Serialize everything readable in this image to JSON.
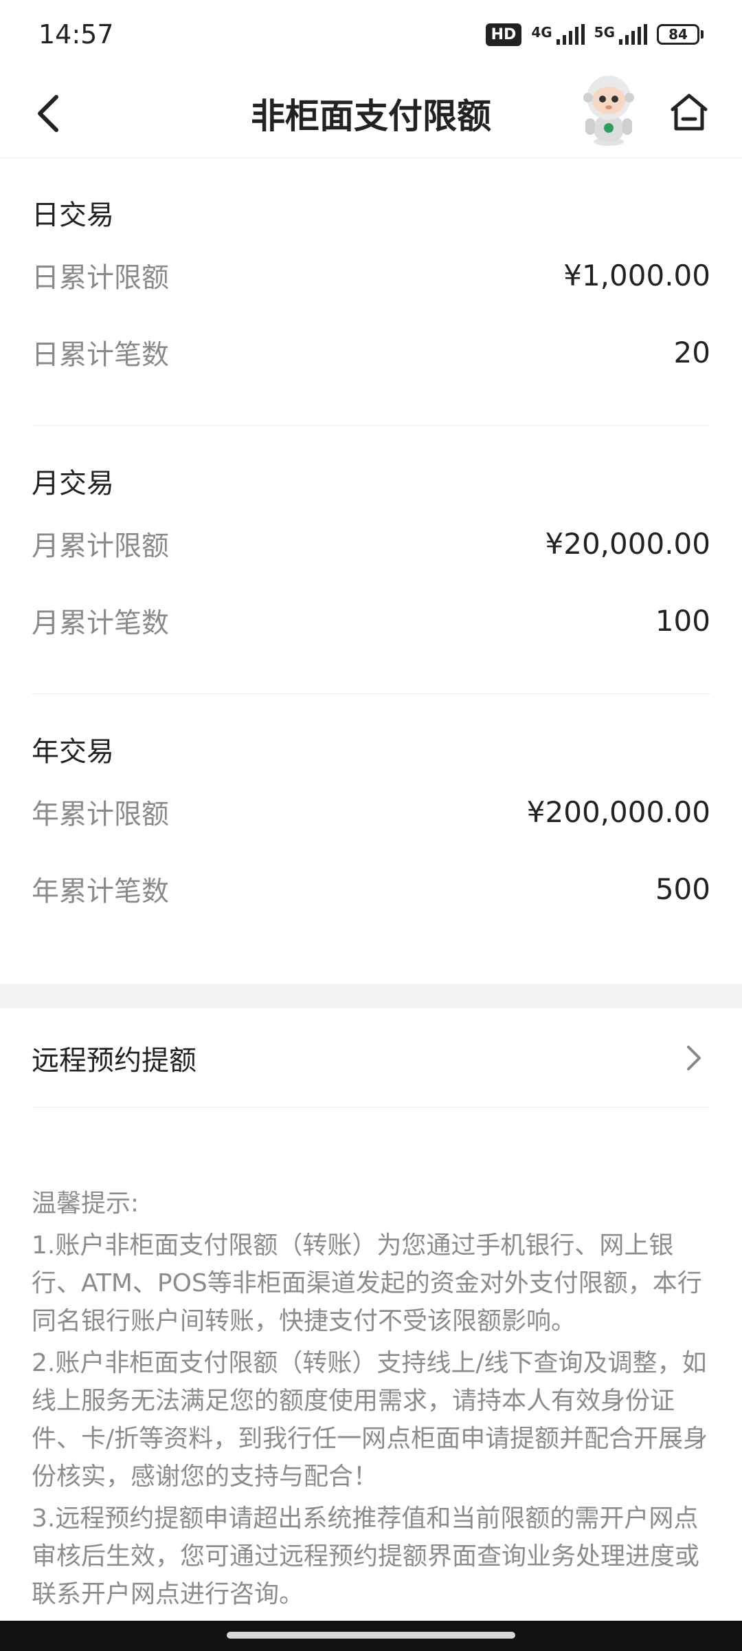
{
  "status_bar": {
    "time": "14:57",
    "hd": "HD",
    "net1": "4G",
    "net2": "5G",
    "battery": "84"
  },
  "nav": {
    "title": "非柜面支付限额",
    "back_icon": "chevron-left-icon",
    "home_icon": "home-icon"
  },
  "daily": {
    "title": "日交易",
    "rows": [
      {
        "label": "日累计限额",
        "value": "¥1,000.00"
      },
      {
        "label": "日累计笔数",
        "value": "20"
      }
    ]
  },
  "monthly": {
    "title": "月交易",
    "rows": [
      {
        "label": "月累计限额",
        "value": "¥20,000.00"
      },
      {
        "label": "月累计笔数",
        "value": "100"
      }
    ]
  },
  "yearly": {
    "title": "年交易",
    "rows": [
      {
        "label": "年累计限额",
        "value": "¥200,000.00"
      },
      {
        "label": "年累计笔数",
        "value": "500"
      }
    ]
  },
  "remote": {
    "label": "远程预约提额",
    "icon": "chevron-right-icon"
  },
  "tips": {
    "heading": "温馨提示:",
    "items": [
      "1.账户非柜面支付限额（转账）为您通过手机银行、网上银行、ATM、POS等非柜面渠道发起的资金对外支付限额，本行同名银行账户间转账，快捷支付不受该限额影响。",
      "2.账户非柜面支付限额（转账）支持线上/线下查询及调整，如线上服务无法满足您的额度使用需求，请持本人有效身份证件、卡/折等资料，到我行任一网点柜面申请提额并配合开展身份核实，感谢您的支持与配合！",
      "3.远程预约提额申请超出系统推荐值和当前限额的需开户网点审核后生效，您可通过远程预约提额界面查询业务处理进度或联系开户网点进行咨询。"
    ]
  }
}
